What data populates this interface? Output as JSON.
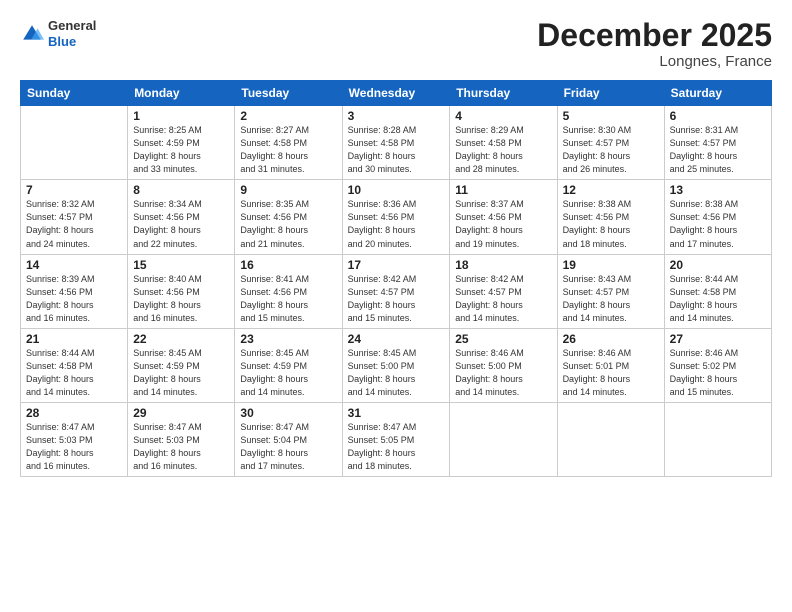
{
  "header": {
    "logo": {
      "general": "General",
      "blue": "Blue"
    },
    "title": "December 2025",
    "location": "Longnes, France"
  },
  "days_of_week": [
    "Sunday",
    "Monday",
    "Tuesday",
    "Wednesday",
    "Thursday",
    "Friday",
    "Saturday"
  ],
  "weeks": [
    [
      {
        "day": "",
        "info": ""
      },
      {
        "day": "1",
        "info": "Sunrise: 8:25 AM\nSunset: 4:59 PM\nDaylight: 8 hours\nand 33 minutes."
      },
      {
        "day": "2",
        "info": "Sunrise: 8:27 AM\nSunset: 4:58 PM\nDaylight: 8 hours\nand 31 minutes."
      },
      {
        "day": "3",
        "info": "Sunrise: 8:28 AM\nSunset: 4:58 PM\nDaylight: 8 hours\nand 30 minutes."
      },
      {
        "day": "4",
        "info": "Sunrise: 8:29 AM\nSunset: 4:58 PM\nDaylight: 8 hours\nand 28 minutes."
      },
      {
        "day": "5",
        "info": "Sunrise: 8:30 AM\nSunset: 4:57 PM\nDaylight: 8 hours\nand 26 minutes."
      },
      {
        "day": "6",
        "info": "Sunrise: 8:31 AM\nSunset: 4:57 PM\nDaylight: 8 hours\nand 25 minutes."
      }
    ],
    [
      {
        "day": "7",
        "info": "Sunrise: 8:32 AM\nSunset: 4:57 PM\nDaylight: 8 hours\nand 24 minutes."
      },
      {
        "day": "8",
        "info": "Sunrise: 8:34 AM\nSunset: 4:56 PM\nDaylight: 8 hours\nand 22 minutes."
      },
      {
        "day": "9",
        "info": "Sunrise: 8:35 AM\nSunset: 4:56 PM\nDaylight: 8 hours\nand 21 minutes."
      },
      {
        "day": "10",
        "info": "Sunrise: 8:36 AM\nSunset: 4:56 PM\nDaylight: 8 hours\nand 20 minutes."
      },
      {
        "day": "11",
        "info": "Sunrise: 8:37 AM\nSunset: 4:56 PM\nDaylight: 8 hours\nand 19 minutes."
      },
      {
        "day": "12",
        "info": "Sunrise: 8:38 AM\nSunset: 4:56 PM\nDaylight: 8 hours\nand 18 minutes."
      },
      {
        "day": "13",
        "info": "Sunrise: 8:38 AM\nSunset: 4:56 PM\nDaylight: 8 hours\nand 17 minutes."
      }
    ],
    [
      {
        "day": "14",
        "info": "Sunrise: 8:39 AM\nSunset: 4:56 PM\nDaylight: 8 hours\nand 16 minutes."
      },
      {
        "day": "15",
        "info": "Sunrise: 8:40 AM\nSunset: 4:56 PM\nDaylight: 8 hours\nand 16 minutes."
      },
      {
        "day": "16",
        "info": "Sunrise: 8:41 AM\nSunset: 4:56 PM\nDaylight: 8 hours\nand 15 minutes."
      },
      {
        "day": "17",
        "info": "Sunrise: 8:42 AM\nSunset: 4:57 PM\nDaylight: 8 hours\nand 15 minutes."
      },
      {
        "day": "18",
        "info": "Sunrise: 8:42 AM\nSunset: 4:57 PM\nDaylight: 8 hours\nand 14 minutes."
      },
      {
        "day": "19",
        "info": "Sunrise: 8:43 AM\nSunset: 4:57 PM\nDaylight: 8 hours\nand 14 minutes."
      },
      {
        "day": "20",
        "info": "Sunrise: 8:44 AM\nSunset: 4:58 PM\nDaylight: 8 hours\nand 14 minutes."
      }
    ],
    [
      {
        "day": "21",
        "info": "Sunrise: 8:44 AM\nSunset: 4:58 PM\nDaylight: 8 hours\nand 14 minutes."
      },
      {
        "day": "22",
        "info": "Sunrise: 8:45 AM\nSunset: 4:59 PM\nDaylight: 8 hours\nand 14 minutes."
      },
      {
        "day": "23",
        "info": "Sunrise: 8:45 AM\nSunset: 4:59 PM\nDaylight: 8 hours\nand 14 minutes."
      },
      {
        "day": "24",
        "info": "Sunrise: 8:45 AM\nSunset: 5:00 PM\nDaylight: 8 hours\nand 14 minutes."
      },
      {
        "day": "25",
        "info": "Sunrise: 8:46 AM\nSunset: 5:00 PM\nDaylight: 8 hours\nand 14 minutes."
      },
      {
        "day": "26",
        "info": "Sunrise: 8:46 AM\nSunset: 5:01 PM\nDaylight: 8 hours\nand 14 minutes."
      },
      {
        "day": "27",
        "info": "Sunrise: 8:46 AM\nSunset: 5:02 PM\nDaylight: 8 hours\nand 15 minutes."
      }
    ],
    [
      {
        "day": "28",
        "info": "Sunrise: 8:47 AM\nSunset: 5:03 PM\nDaylight: 8 hours\nand 16 minutes."
      },
      {
        "day": "29",
        "info": "Sunrise: 8:47 AM\nSunset: 5:03 PM\nDaylight: 8 hours\nand 16 minutes."
      },
      {
        "day": "30",
        "info": "Sunrise: 8:47 AM\nSunset: 5:04 PM\nDaylight: 8 hours\nand 17 minutes."
      },
      {
        "day": "31",
        "info": "Sunrise: 8:47 AM\nSunset: 5:05 PM\nDaylight: 8 hours\nand 18 minutes."
      },
      {
        "day": "",
        "info": ""
      },
      {
        "day": "",
        "info": ""
      },
      {
        "day": "",
        "info": ""
      }
    ]
  ]
}
